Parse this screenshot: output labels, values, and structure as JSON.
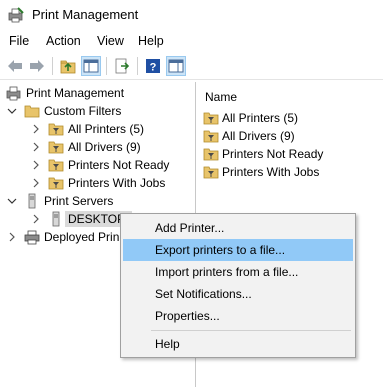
{
  "window": {
    "title": "Print Management",
    "icon": "print-management-icon"
  },
  "menubar": {
    "items": [
      "File",
      "Action",
      "View",
      "Help"
    ]
  },
  "toolbar": {
    "buttons": [
      "back-arrow-icon",
      "forward-arrow-icon",
      "up-folder-icon",
      "show-hide-tree-icon",
      "export-list-icon",
      "help-icon",
      "show-hide-action-pane-icon"
    ]
  },
  "tree": {
    "root": "Print Management",
    "custom_filters": "Custom Filters",
    "filters": [
      "All Printers (5)",
      "All Drivers (9)",
      "Printers Not Ready",
      "Printers With Jobs"
    ],
    "print_servers": "Print Servers",
    "server_name": "DESKTOP-",
    "deployed": "Deployed Prin"
  },
  "list": {
    "column_header": "Name",
    "items": [
      "All Printers (5)",
      "All Drivers (9)",
      "Printers Not Ready",
      "Printers With Jobs"
    ]
  },
  "context_menu": {
    "items": [
      "Add Printer...",
      "Export printers to a file...",
      "Import printers from a file...",
      "Set Notifications...",
      "Properties...",
      "Help"
    ],
    "hovered_index": 1
  },
  "colors": {
    "hover": "#91c9f7",
    "selected": "#dadada",
    "menu_bg": "#f2f2f2"
  }
}
